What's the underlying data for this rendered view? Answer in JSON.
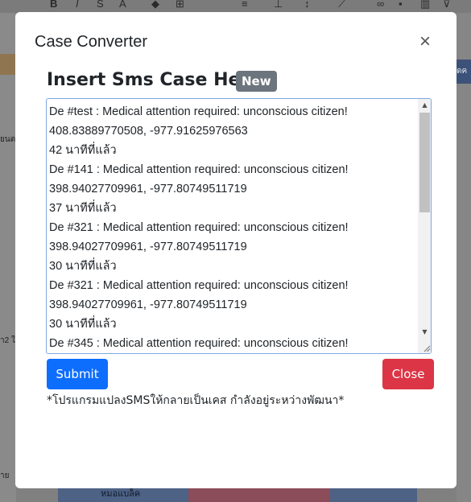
{
  "modal": {
    "title": "Case Converter",
    "close_symbol": "×",
    "heading": "Insert Sms Case Here",
    "badge": "New",
    "textarea_value": "De #test : Medical attention required: unconscious citizen!\n408.83889770508, -977.91625976563\n42 นาทีที่แล้ว\nDe #141 : Medical attention required: unconscious citizen!\n398.94027709961, -977.80749511719\n37 นาทีที่แล้ว\nDe #321 : Medical attention required: unconscious citizen!\n398.94027709961, -977.80749511719\n30 นาทีที่แล้ว\nDe #321 : Medical attention required: unconscious citizen!\n398.94027709961, -977.80749511719\n30 นาทีที่แล้ว\nDe #345 : Medical attention required: unconscious citizen!",
    "submit_label": "Submit",
    "close_label": "Close",
    "footnote": "*โปรแกรมแปลงSMSให้กลายเป็นเคส กำลังอยู่ระหว่างพัฒนา*"
  },
  "background": {
    "right_header": "ดค",
    "bottom_label": "หมอแบล็ค",
    "left_fragments": [
      "ยนต",
      "า2 ใ",
      "าย"
    ]
  },
  "colors": {
    "primary": "#0d6efd",
    "danger": "#dc3545",
    "badge": "#6c757d",
    "backdrop": "#808080"
  },
  "icons": [
    "close-icon",
    "scroll-up-icon",
    "scroll-down-icon",
    "resize-grip-icon"
  ]
}
